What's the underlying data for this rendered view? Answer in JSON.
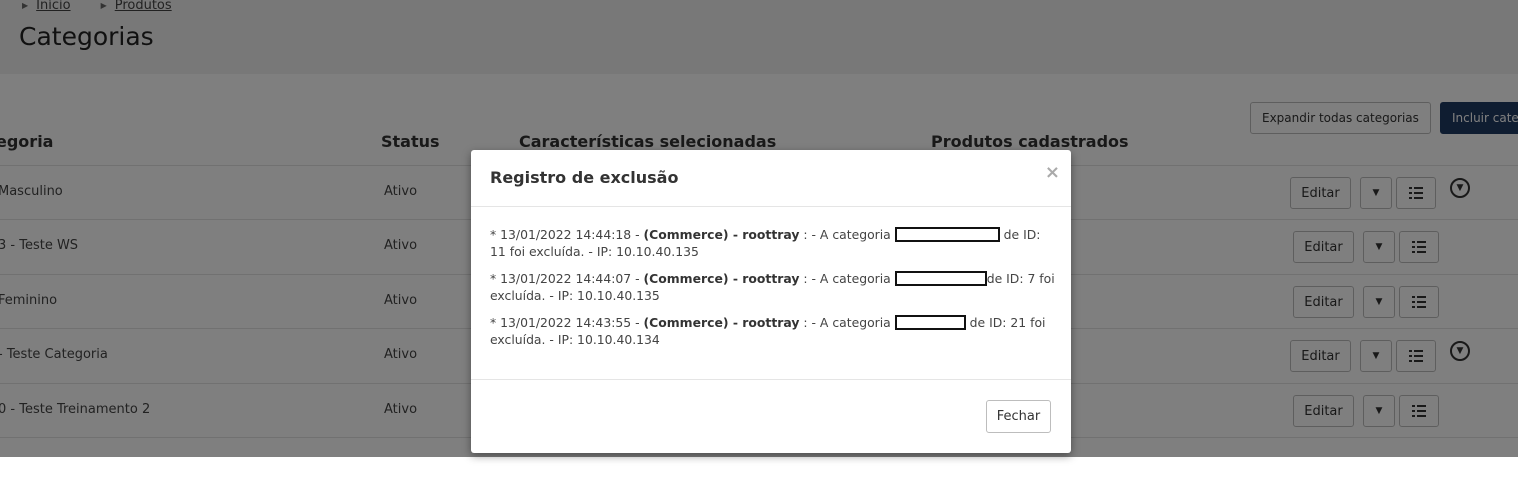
{
  "breadcrumb": {
    "items": [
      "Início",
      "Produtos"
    ]
  },
  "page": {
    "title": "Categorias"
  },
  "toolbar": {
    "expand_all": "Expandir todas categorias",
    "include_category": "Incluir cate"
  },
  "table": {
    "headers": {
      "category": "egoria",
      "status": "Status",
      "features": "Características selecionadas",
      "products": "Produtos cadastrados"
    },
    "rows": [
      {
        "name": "Masculino",
        "status": "Ativo",
        "edit": "Editar"
      },
      {
        "name": "3 - Teste WS",
        "status": "Ativo",
        "edit": "Editar"
      },
      {
        "name": "Feminino",
        "status": "Ativo",
        "edit": "Editar"
      },
      {
        "name": "- Teste Categoria",
        "status": "Ativo",
        "edit": "Editar"
      },
      {
        "name": "0 - Teste Treinamento 2",
        "status": "Ativo",
        "edit": "Editar"
      }
    ]
  },
  "modal": {
    "title": "Registro de exclusão",
    "close_symbol": "×",
    "entries": [
      {
        "prefix": "* 13/01/2022 14:44:18 - ",
        "source": "(Commerce) - roottray",
        "middle": " : - A categoria ",
        "suffix": " de ID: 11 foi excluída. - IP: 10.10.40.135"
      },
      {
        "prefix": "* 13/01/2022 14:44:07 - ",
        "source": "(Commerce) - roottray",
        "middle": " : - A categoria ",
        "suffix": "de ID: 7 foi excluída. - IP: 10.10.40.135"
      },
      {
        "prefix": "* 13/01/2022 14:43:55 - ",
        "source": "(Commerce) - roottray",
        "middle": " : - A categoria ",
        "suffix": " de ID: 21 foi excluída. - IP: 10.10.40.134"
      }
    ],
    "close_button": "Fechar"
  },
  "icons": {
    "caret": "caret-right-icon",
    "dropdown": "chevron-down-icon",
    "list": "list-icon",
    "expand": "circle-chevron-down-icon"
  }
}
